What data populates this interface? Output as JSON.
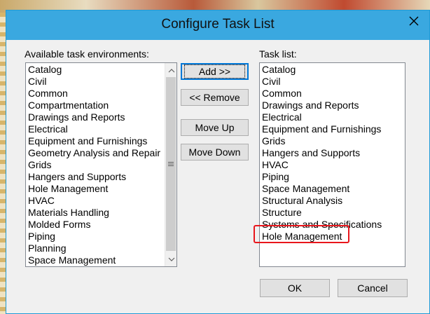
{
  "window": {
    "title": "Configure Task List"
  },
  "available": {
    "label": "Available task environments:",
    "items": [
      "Catalog",
      "Civil",
      "Common",
      "Compartmentation",
      "Drawings and Reports",
      "Electrical",
      "Equipment and Furnishings",
      "Geometry Analysis and Repair",
      "Grids",
      "Hangers and Supports",
      "Hole Management",
      "HVAC",
      "Materials Handling",
      "Molded Forms",
      "Piping",
      "Planning",
      "Space Management"
    ]
  },
  "tasklist": {
    "label": "Task list:",
    "items": [
      "Catalog",
      "Civil",
      "Common",
      "Drawings and Reports",
      "Electrical",
      "Equipment and Furnishings",
      "Grids",
      "Hangers and Supports",
      "HVAC",
      "Piping",
      "Space Management",
      "Structural Analysis",
      "Structure",
      "Systems and Specifications",
      "Hole Management"
    ]
  },
  "buttons": {
    "add": "Add >>",
    "remove": "<< Remove",
    "move_up": "Move Up",
    "move_down": "Move Down",
    "ok": "OK",
    "cancel": "Cancel"
  },
  "colors": {
    "titlebar": "#3aa8e0",
    "highlight": "#e8161c"
  },
  "icons": {
    "close": "close-icon",
    "scroll_up": "chevron-up-icon",
    "scroll_down": "chevron-down-icon",
    "grip": "scroll-grip-icon"
  }
}
